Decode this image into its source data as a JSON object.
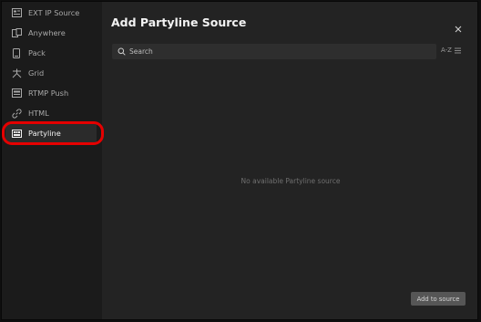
{
  "sidebar": {
    "items": [
      {
        "label": "EXT IP Source",
        "icon": "ext-ip-source-icon"
      },
      {
        "label": "Anywhere",
        "icon": "anywhere-icon"
      },
      {
        "label": "Pack",
        "icon": "pack-icon"
      },
      {
        "label": "Grid",
        "icon": "grid-icon"
      },
      {
        "label": "RTMP Push",
        "icon": "rtmp-push-icon"
      },
      {
        "label": "HTML",
        "icon": "link-icon"
      },
      {
        "label": "Partyline",
        "icon": "partyline-icon",
        "active": true
      }
    ]
  },
  "dialog": {
    "title": "Add Partyline Source",
    "empty_message": "No available Partyline source",
    "add_button_label": "Add to source"
  },
  "search": {
    "placeholder": "Search"
  },
  "sort": {
    "label": "A-Z"
  },
  "colors": {
    "highlight": "#e50000",
    "dialog_bg": "#232323",
    "sidebar_bg": "#1b1b1b"
  }
}
